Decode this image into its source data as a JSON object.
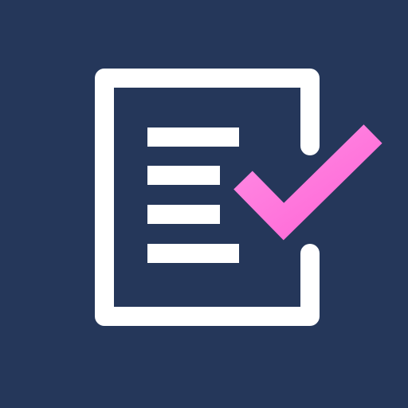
{
  "app_icon": {
    "name": "checklist-document-icon",
    "description_colors": {
      "background": "#25375a",
      "document_outline": "#ffffff",
      "text_lines": "#ffffff",
      "checkmark_top": "#ff66d6",
      "checkmark_bottom": "#ff8de4"
    },
    "text_line_count": 4,
    "has_checkmark": true
  }
}
